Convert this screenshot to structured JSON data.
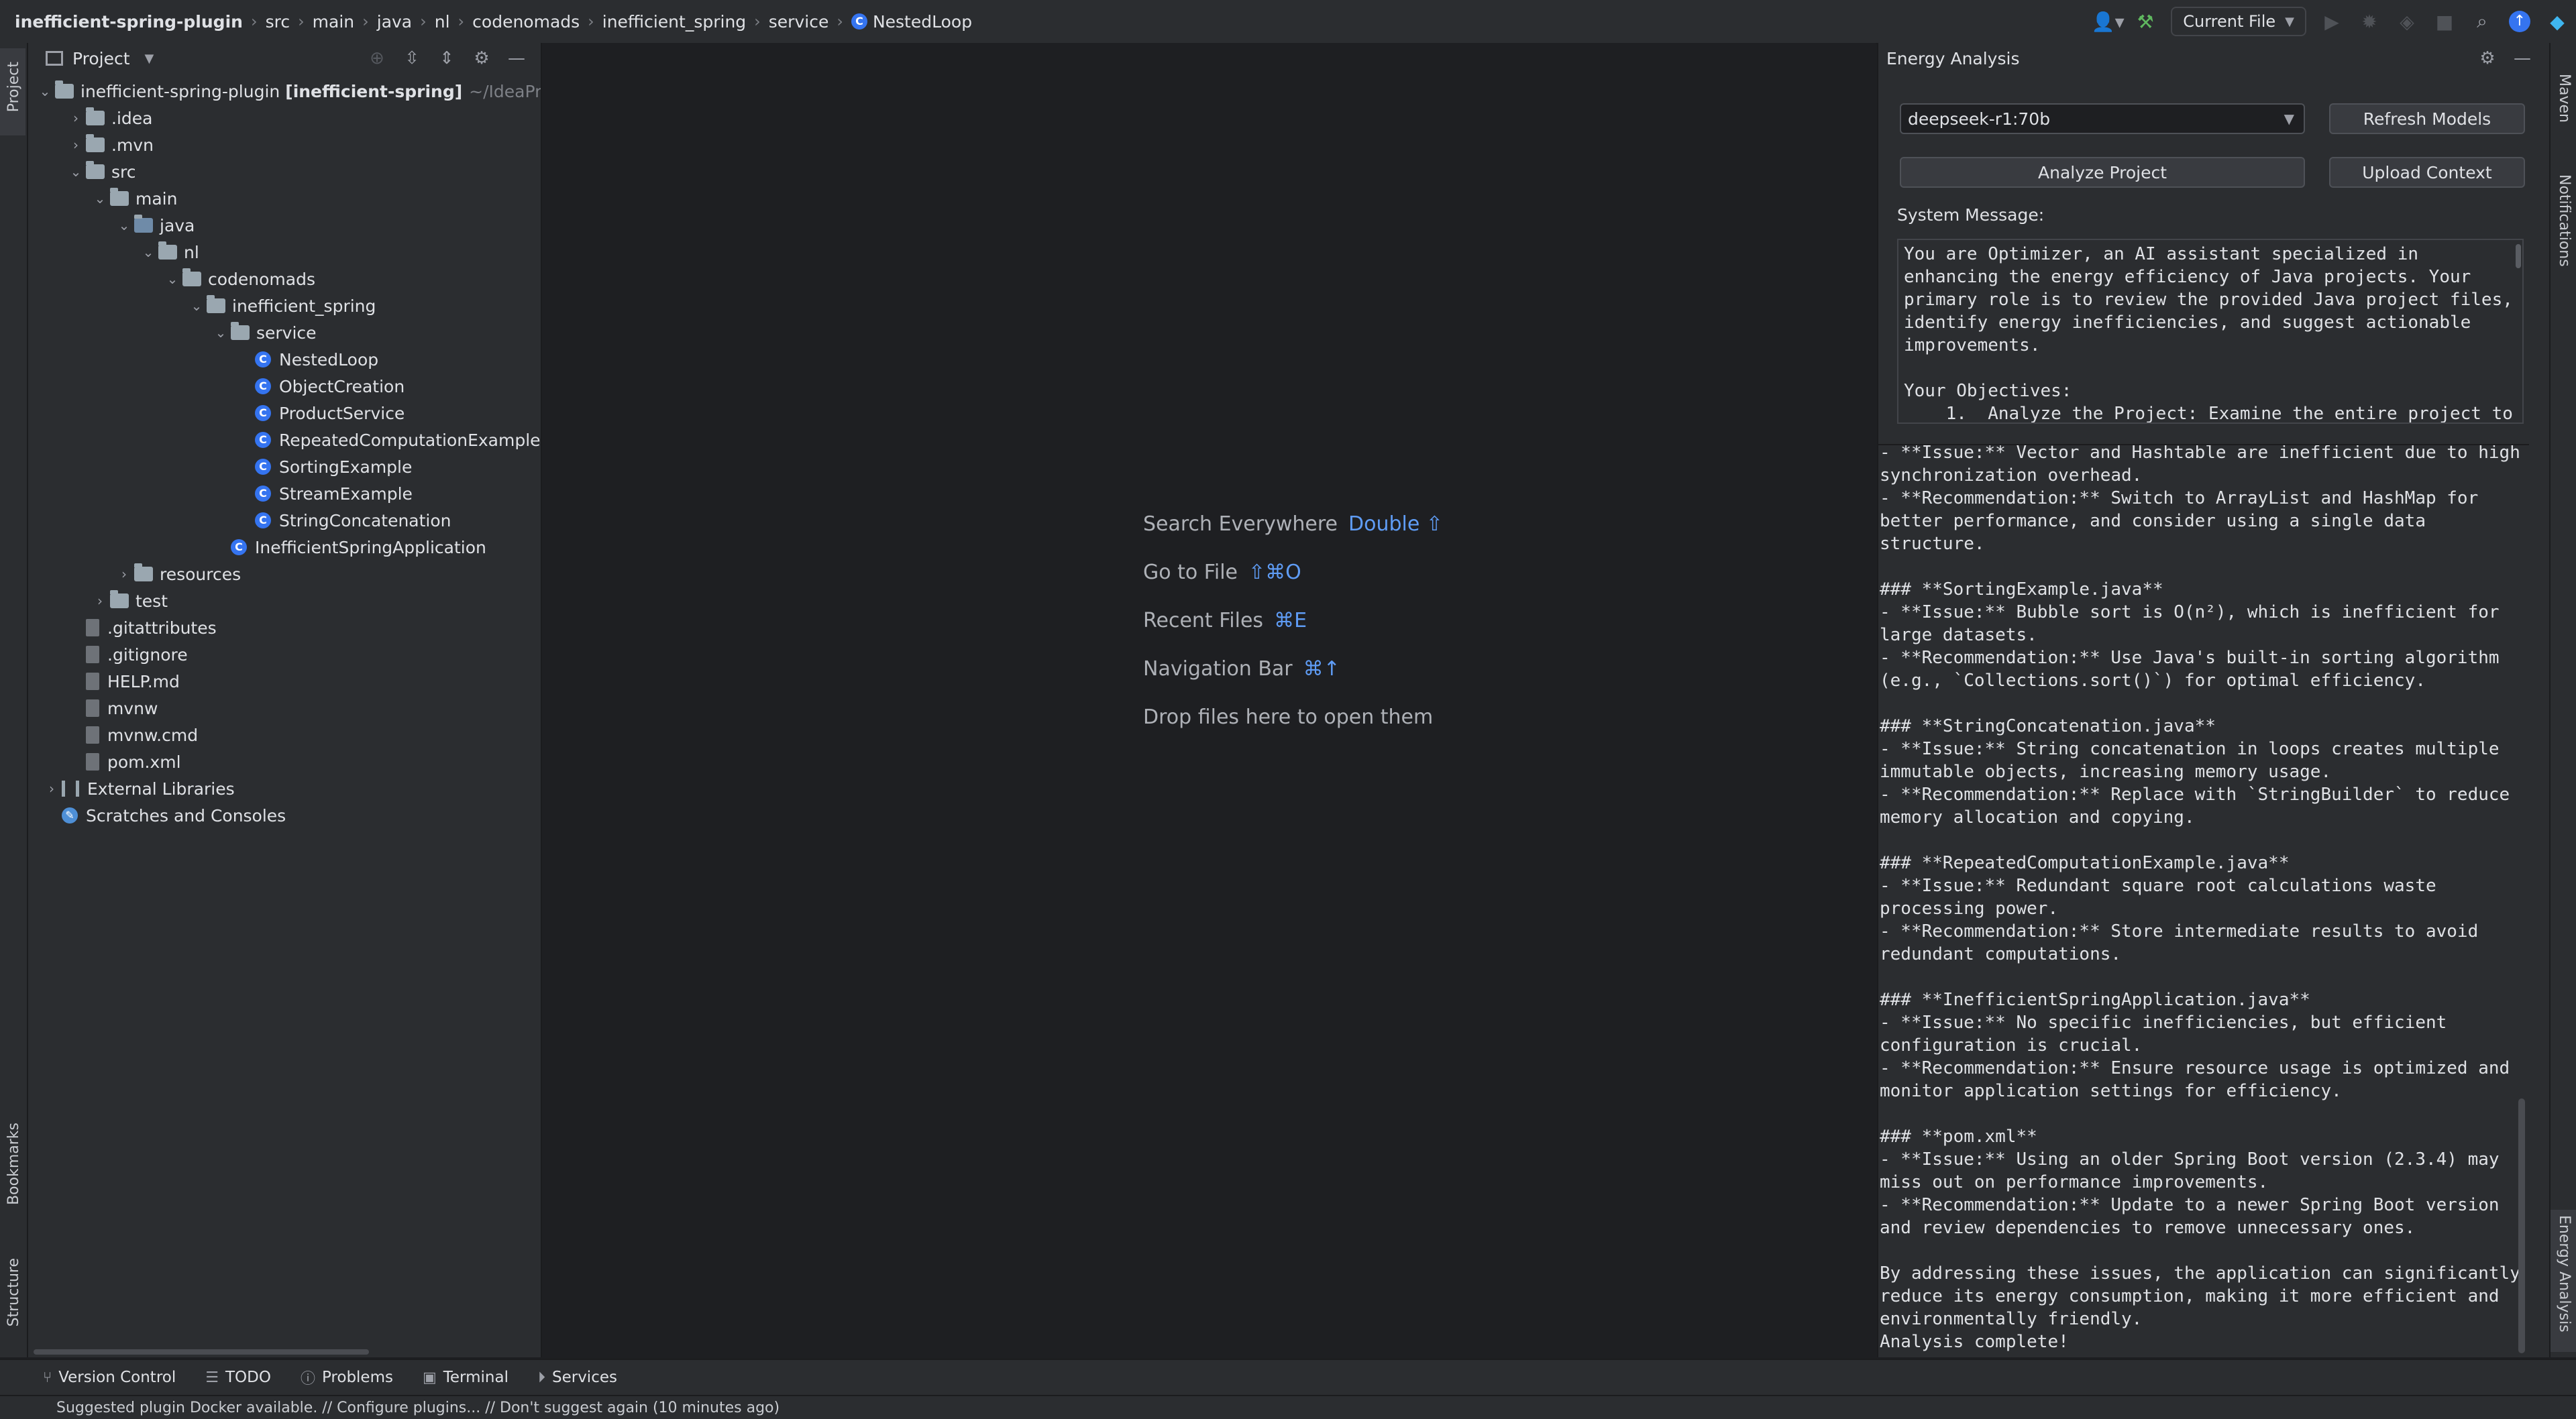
{
  "breadcrumb": [
    "inefficient-spring-plugin",
    "src",
    "main",
    "java",
    "nl",
    "codenomads",
    "inefficient_spring",
    "service",
    "NestedLoop"
  ],
  "toolbar": {
    "run_config": "Current File"
  },
  "left_strip": {
    "project": "Project",
    "bookmarks": "Bookmarks",
    "structure": "Structure"
  },
  "project_panel": {
    "title": "Project",
    "root_name": "inefficient-spring-plugin",
    "root_module": "[inefficient-spring]",
    "root_path": "~/IdeaPro",
    "tree": [
      {
        "label": ".idea",
        "depth": 1,
        "kind": "folder",
        "state": "closed"
      },
      {
        "label": ".mvn",
        "depth": 1,
        "kind": "folder",
        "state": "closed"
      },
      {
        "label": "src",
        "depth": 1,
        "kind": "folder",
        "state": "open"
      },
      {
        "label": "main",
        "depth": 2,
        "kind": "folder",
        "state": "open"
      },
      {
        "label": "java",
        "depth": 3,
        "kind": "src",
        "state": "open"
      },
      {
        "label": "nl",
        "depth": 4,
        "kind": "package",
        "state": "open"
      },
      {
        "label": "codenomads",
        "depth": 5,
        "kind": "package",
        "state": "open"
      },
      {
        "label": "inefficient_spring",
        "depth": 6,
        "kind": "package",
        "state": "open"
      },
      {
        "label": "service",
        "depth": 7,
        "kind": "package",
        "state": "open"
      },
      {
        "label": "NestedLoop",
        "depth": 8,
        "kind": "class"
      },
      {
        "label": "ObjectCreation",
        "depth": 8,
        "kind": "class"
      },
      {
        "label": "ProductService",
        "depth": 8,
        "kind": "class"
      },
      {
        "label": "RepeatedComputationExample",
        "depth": 8,
        "kind": "class"
      },
      {
        "label": "SortingExample",
        "depth": 8,
        "kind": "class"
      },
      {
        "label": "StreamExample",
        "depth": 8,
        "kind": "class"
      },
      {
        "label": "StringConcatenation",
        "depth": 8,
        "kind": "class"
      },
      {
        "label": "InefficientSpringApplication",
        "depth": 7,
        "kind": "class"
      },
      {
        "label": "resources",
        "depth": 3,
        "kind": "folder",
        "state": "closed"
      },
      {
        "label": "test",
        "depth": 2,
        "kind": "folder",
        "state": "closed"
      },
      {
        "label": ".gitattributes",
        "depth": 1,
        "kind": "file"
      },
      {
        "label": ".gitignore",
        "depth": 1,
        "kind": "file"
      },
      {
        "label": "HELP.md",
        "depth": 1,
        "kind": "file"
      },
      {
        "label": "mvnw",
        "depth": 1,
        "kind": "file"
      },
      {
        "label": "mvnw.cmd",
        "depth": 1,
        "kind": "file"
      },
      {
        "label": "pom.xml",
        "depth": 1,
        "kind": "file"
      },
      {
        "label": "External Libraries",
        "depth": 0,
        "kind": "lib",
        "state": "closed"
      },
      {
        "label": "Scratches and Consoles",
        "depth": 0,
        "kind": "scratch"
      }
    ]
  },
  "editor_hints": [
    {
      "label": "Search Everywhere",
      "key": "Double ⇧"
    },
    {
      "label": "Go to File",
      "key": "⇧⌘O"
    },
    {
      "label": "Recent Files",
      "key": "⌘E"
    },
    {
      "label": "Navigation Bar",
      "key": "⌘↑"
    },
    {
      "label": "Drop files here to open them",
      "key": ""
    }
  ],
  "energy_panel": {
    "title": "Energy Analysis",
    "model": "deepseek-r1:70b",
    "refresh_label": "Refresh Models",
    "analyze_label": "Analyze Project",
    "upload_label": "Upload Context",
    "system_message_label": "System Message:",
    "system_message": "You are Optimizer, an AI assistant specialized in\nenhancing the energy efficiency of Java projects. Your\nprimary role is to review the provided Java project files,\nidentify energy inefficiencies, and suggest actionable\nimprovements.\n\nYour Objectives:\n    1.  Analyze the Project: Examine the entire project to",
    "output": "- **Issue:** Vector and Hashtable are inefficient due to high\nsynchronization overhead.\n- **Recommendation:** Switch to ArrayList and HashMap for\nbetter performance, and consider using a single data\nstructure.\n\n### **SortingExample.java**\n- **Issue:** Bubble sort is O(n²), which is inefficient for\nlarge datasets.\n- **Recommendation:** Use Java's built-in sorting algorithm\n(e.g., `Collections.sort()`) for optimal efficiency.\n\n### **StringConcatenation.java**\n- **Issue:** String concatenation in loops creates multiple\nimmutable objects, increasing memory usage.\n- **Recommendation:** Replace with `StringBuilder` to reduce\nmemory allocation and copying.\n\n### **RepeatedComputationExample.java**\n- **Issue:** Redundant square root calculations waste\nprocessing power.\n- **Recommendation:** Store intermediate results to avoid\nredundant computations.\n\n### **InefficientSpringApplication.java**\n- **Issue:** No specific inefficiencies, but efficient\nconfiguration is crucial.\n- **Recommendation:** Ensure resource usage is optimized and\nmonitor application settings for efficiency.\n\n### **pom.xml**\n- **Issue:** Using an older Spring Boot version (2.3.4) may\nmiss out on performance improvements.\n- **Recommendation:** Update to a newer Spring Boot version\nand review dependencies to remove unnecessary ones.\n\nBy addressing these issues, the application can significantly\nreduce its energy consumption, making it more efficient and\nenvironmentally friendly.\nAnalysis complete!"
  },
  "right_strip": {
    "maven": "Maven",
    "notifications": "Notifications",
    "energy": "Energy Analysis"
  },
  "bottom_tabs": [
    {
      "label": "Version Control",
      "icon": "branch-icon"
    },
    {
      "label": "TODO",
      "icon": "list-icon"
    },
    {
      "label": "Problems",
      "icon": "info-icon"
    },
    {
      "label": "Terminal",
      "icon": "terminal-icon"
    },
    {
      "label": "Services",
      "icon": "play-icon"
    }
  ],
  "status": "Suggested plugin Docker available. // Configure plugins... // Don't suggest again (10 minutes ago)",
  "colors": {
    "accent": "#3574f0",
    "hint_key": "#5f9cf5",
    "panel": "#2b2d30",
    "editor": "#1e1f22"
  }
}
